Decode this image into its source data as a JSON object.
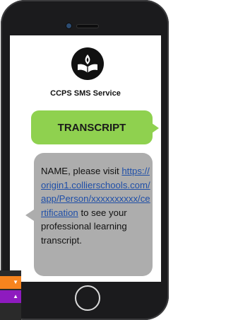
{
  "app": {
    "service_name": "CCPS SMS Service"
  },
  "messages": {
    "outgoing": "TRANSCRIPT",
    "incoming_prefix": "NAME, please visit ",
    "incoming_link": "https://origin1.collierschools.com/app/Person/xxxxxxxxxx/certification",
    "incoming_suffix": " to see your professional learning transcript."
  },
  "colors": {
    "outgoing_bubble": "#8fd14f",
    "incoming_bubble": "#adadad",
    "link": "#1f4fa8",
    "side_orange": "#f7841e",
    "side_purple": "#8e1bbf"
  },
  "icons": {
    "logo": "open-book-flame-logo",
    "side_row_orange": "caret-down-icon",
    "side_row_purple": "caret-up-icon"
  }
}
